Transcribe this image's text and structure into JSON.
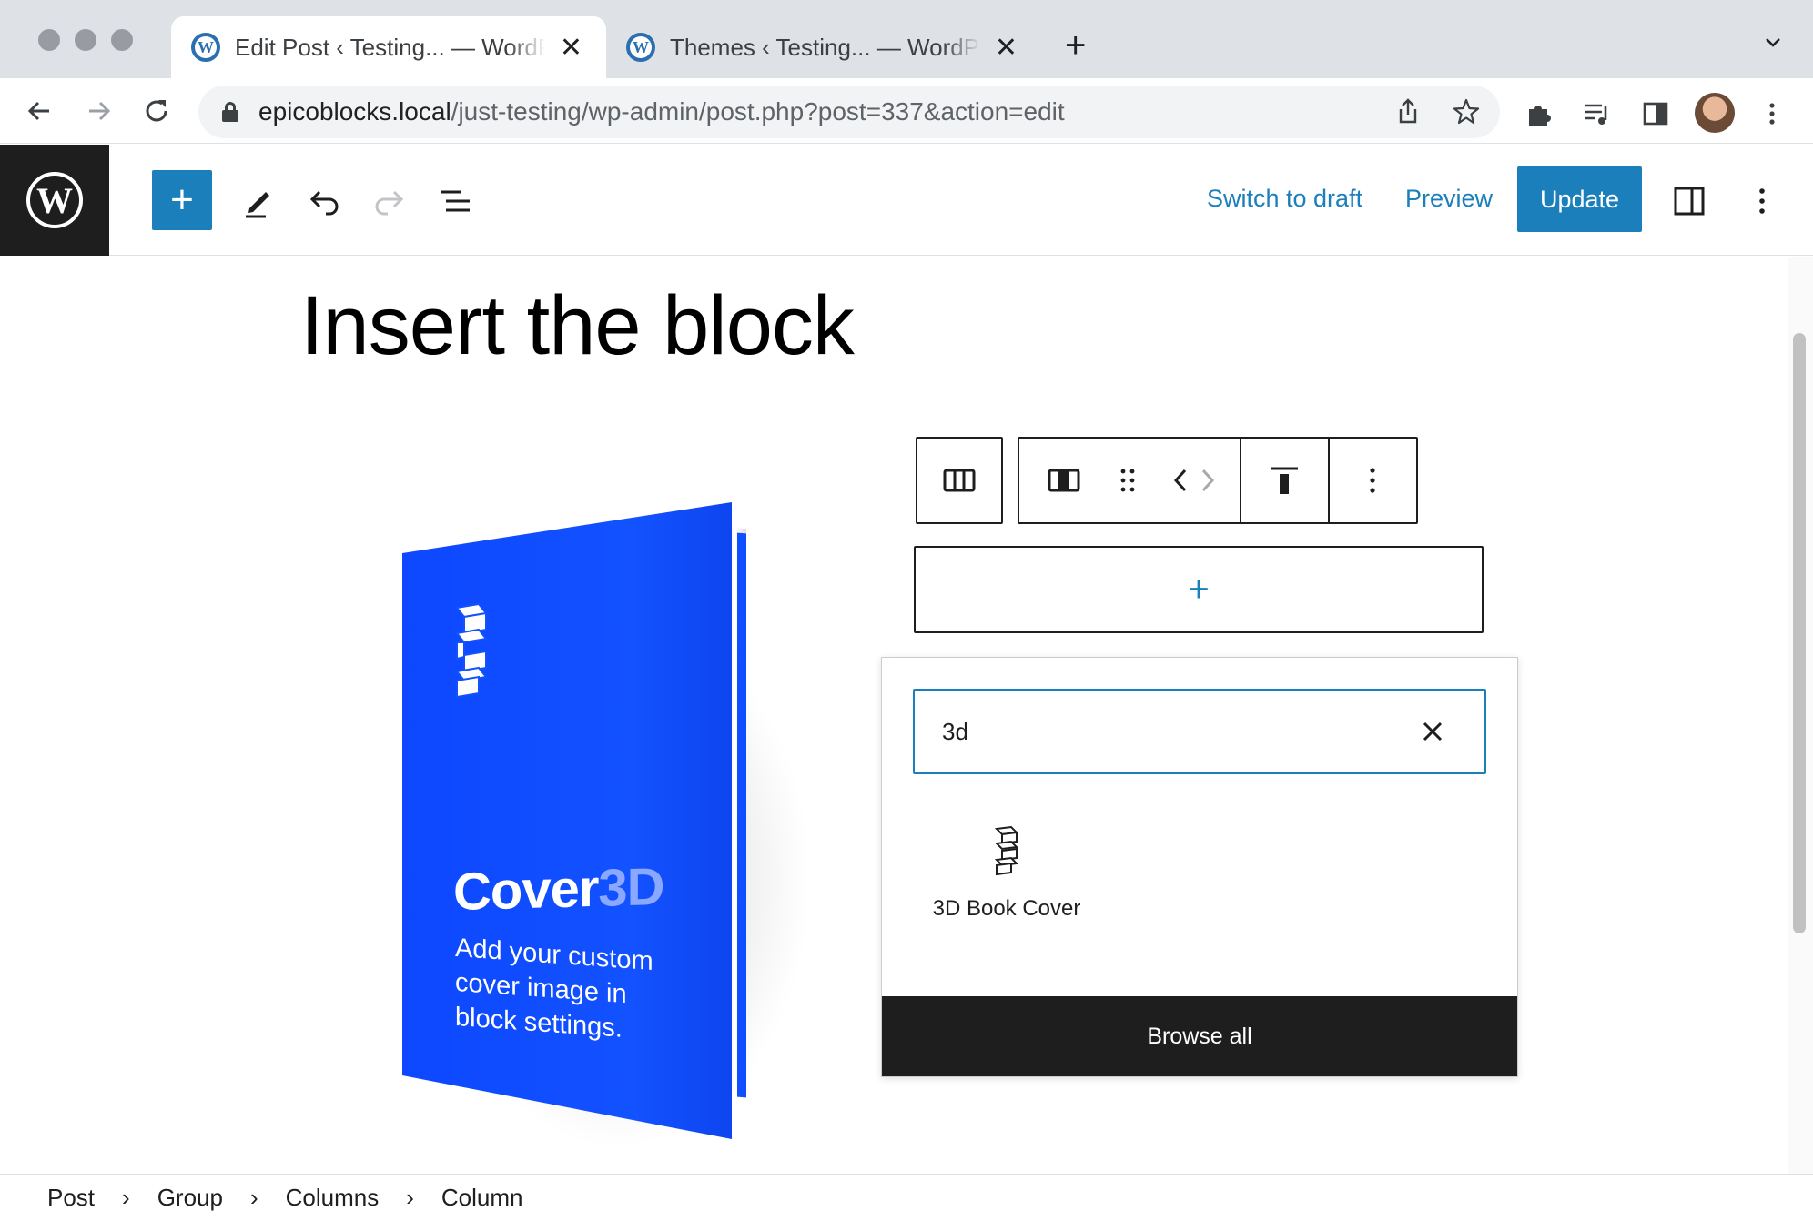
{
  "browser": {
    "tabs": [
      {
        "title": "Edit Post ‹ Testing... — WordPress",
        "active": true
      },
      {
        "title": "Themes ‹ Testing... — WordPress",
        "active": false
      }
    ],
    "url_domain": "epicoblocks.local",
    "url_path": "/just-testing/wp-admin/post.php?post=337&action=edit"
  },
  "editor": {
    "header": {
      "switch_to_draft": "Switch to draft",
      "preview": "Preview",
      "update": "Update"
    },
    "post_title": "Insert the block",
    "book": {
      "title_main": "Cover",
      "title_accent": "3D",
      "subtitle": "Add your custom cover image in block settings."
    },
    "inserter": {
      "search_value": "3d",
      "results": [
        {
          "label": "3D Book Cover",
          "icon": "book-cover-icon"
        }
      ],
      "browse_all": "Browse all"
    },
    "breadcrumb": [
      "Post",
      "Group",
      "Columns",
      "Column"
    ]
  },
  "colors": {
    "accent": "#1a7fba",
    "book_blue": "#0d47ff",
    "dark": "#1e1e1e"
  }
}
